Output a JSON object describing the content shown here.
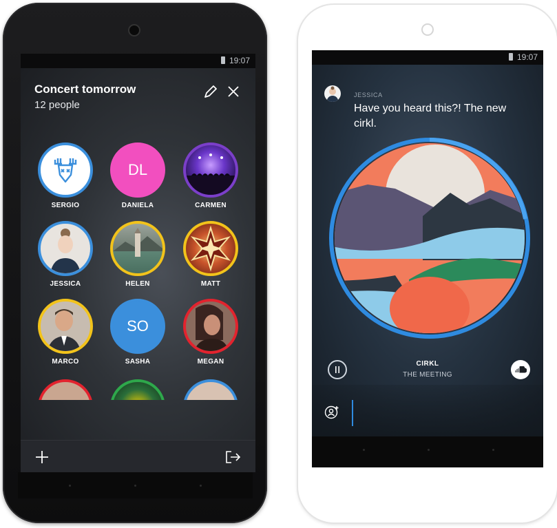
{
  "left_phone": {
    "status": {
      "time": "19:07"
    },
    "group": {
      "title": "Concert tomorrow",
      "subtitle": "12 people"
    },
    "icons": {
      "edit": "pencil-icon",
      "close": "close-icon",
      "add": "plus-icon",
      "leave": "exit-icon"
    },
    "members": [
      {
        "name": "SERGIO",
        "ring": "#3b8fdc",
        "fill": "#ffffff",
        "type": "deer-logo"
      },
      {
        "name": "DANIELA",
        "ring": "#f24fbf",
        "fill": "#f24fbf",
        "initials": "DL"
      },
      {
        "name": "CARMEN",
        "ring": "#7b3fc9",
        "fill": "#3c1d7a",
        "type": "concert-photo"
      },
      {
        "name": "JESSICA",
        "ring": "#3b8fdc",
        "fill": "#d9d4cf",
        "type": "portrait"
      },
      {
        "name": "HELEN",
        "ring": "#f2c31b",
        "fill": "#7d8a76",
        "type": "tower-photo"
      },
      {
        "name": "MATT",
        "ring": "#f2c31b",
        "fill": "#7a2c14",
        "type": "star-pattern"
      },
      {
        "name": "MARCO",
        "ring": "#f2c31b",
        "fill": "#b0a394",
        "type": "portrait"
      },
      {
        "name": "SASHA",
        "ring": "#3b8fdc",
        "fill": "#3b8fdc",
        "initials": "SO"
      },
      {
        "name": "MEGAN",
        "ring": "#e2232e",
        "fill": "#6b4a3f",
        "type": "portrait"
      }
    ],
    "partial_rings": [
      "#e2232e",
      "#2ea84b",
      "#3b8fdc"
    ]
  },
  "right_phone": {
    "status": {
      "time": "19:07"
    },
    "message": {
      "sender": "JESSICA",
      "text": "Have you heard this?! The new cirkl."
    },
    "track": {
      "title": "CIRKL",
      "artist": "THE MEETING",
      "progress": 0.08
    },
    "icons": {
      "pause": "pause-icon",
      "source": "soundcloud-icon",
      "invite": "add-person-icon"
    },
    "colors": {
      "accent": "#2f8be0",
      "orange": "#f0684a",
      "sky": "#8ecbe9"
    }
  }
}
